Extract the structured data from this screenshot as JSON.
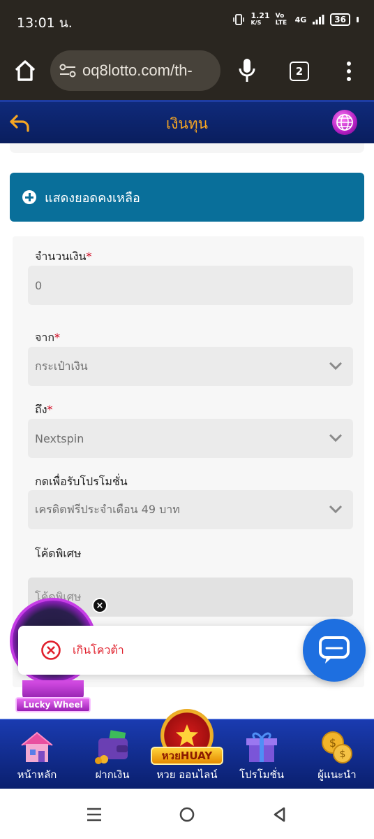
{
  "status_bar": {
    "time": "13:01 น.",
    "net_speed": "1.21",
    "net_unit": "K/S",
    "volte": "Vo LTE",
    "network": "4G",
    "battery": "36"
  },
  "browser": {
    "url": "oq8lotto.com/th-",
    "tab_count": "2"
  },
  "header": {
    "title": "เงินทุน"
  },
  "balance": {
    "label": "แสดงยอดคงเหลือ"
  },
  "form": {
    "amount": {
      "label": "จำนวนเงิน",
      "required": "*",
      "value": "0"
    },
    "from": {
      "label": "จาก",
      "required": "*",
      "value": "กระเป๋าเงิน"
    },
    "to": {
      "label": "ถึง",
      "required": "*",
      "value": "Nextspin"
    },
    "promotion": {
      "label": "กดเพื่อรับโปรโมชั่น",
      "value": "เครดิตฟรีประจำเดือน 49 บาท"
    },
    "special_code": {
      "label": "โค้ดพิเศษ",
      "placeholder": "โค้ดพิเศษ"
    }
  },
  "toast": {
    "message": "เกินโควต้า"
  },
  "lucky_wheel": {
    "label": "Lucky Wheel",
    "close": "×"
  },
  "bottom_nav": {
    "items": [
      {
        "label": "หน้าหลัก",
        "icon": "house-icon"
      },
      {
        "label": "ฝากเงิน",
        "icon": "wallet-icon"
      },
      {
        "label": "หวย ออนไลน์",
        "icon": "huay-badge-icon",
        "badge": "หวยHUAY"
      },
      {
        "label": "โปรโมชั่น",
        "icon": "gift-icon"
      },
      {
        "label": "ผู้แนะนำ",
        "icon": "coins-icon"
      }
    ]
  },
  "colors": {
    "header_bg": "#0f2a7a",
    "title_accent": "#f6a623",
    "balance_bar": "#096f9a",
    "required": "#d0021b",
    "toast_error": "#e0202c",
    "chat_button": "#1e6fe0"
  }
}
